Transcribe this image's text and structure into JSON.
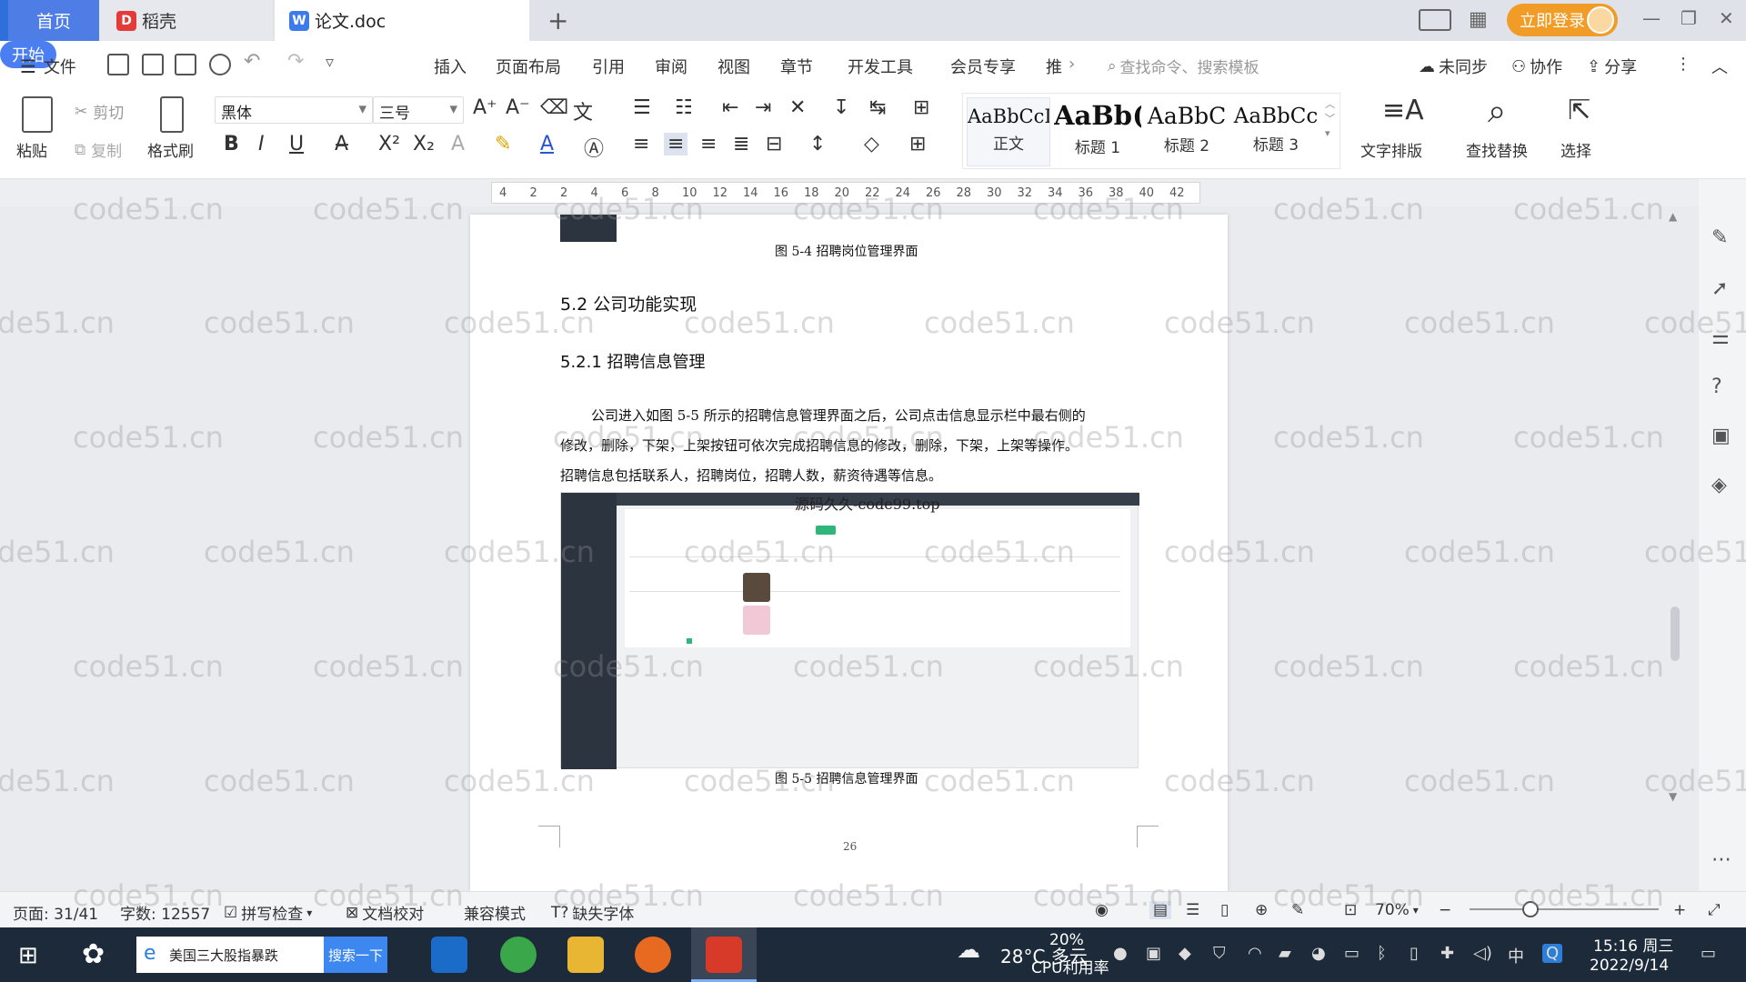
{
  "tabs": {
    "home": "首页",
    "daoke": "稻壳",
    "doc": "论文.doc",
    "new_tab": "+"
  },
  "top_right": {
    "login": "立即登录"
  },
  "menu": {
    "file": "文件",
    "items": [
      "开始",
      "插入",
      "页面布局",
      "引用",
      "审阅",
      "视图",
      "章节",
      "开发工具",
      "会员专享",
      "推"
    ],
    "search_cmd": "查找命令、搜索模板",
    "unsync": "未同步",
    "collab": "协作",
    "share": "分享"
  },
  "ribbon": {
    "paste": "粘贴",
    "cut": "剪切",
    "copy": "复制",
    "format_painter": "格式刷",
    "font": "黑体",
    "font_size": "三号",
    "styles": [
      {
        "sample": "AaBbCcI",
        "name": "正文"
      },
      {
        "sample": "AaBb(",
        "name": "标题 1"
      },
      {
        "sample": "AaBbC",
        "name": "标题 2"
      },
      {
        "sample": "AaBbCc",
        "name": "标题 3"
      }
    ],
    "text_layout": "文字排版",
    "find_replace": "查找替换",
    "select": "选择"
  },
  "ruler": {
    "ticks": [
      "4",
      "2",
      "2",
      "4",
      "6",
      "8",
      "10",
      "12",
      "14",
      "16",
      "18",
      "20",
      "22",
      "24",
      "26",
      "28",
      "30",
      "32",
      "34",
      "36",
      "38",
      "40",
      "42"
    ]
  },
  "document": {
    "caption_top": "图 5-4  招聘岗位管理界面",
    "section": "5.2 公司功能实现",
    "subsection": "5.2.1  招聘信息管理",
    "para_lines": [
      "公司进入如图 5-5 所示的招聘信息管理界面之后，公司点击信息显示栏中最右侧的",
      "修改，删除，下架，上架按钮可依次完成招聘信息的修改，删除，下架，上架等操作。",
      "招聘信息包括联系人，招聘岗位，招聘人数，薪资待遇等信息。"
    ],
    "overlay_text": "源码久久-code99.top",
    "caption_bottom": "图 5-5  招聘信息管理界面",
    "page_number": "26"
  },
  "watermark": "code51.cn",
  "status": {
    "page": "页面: 31/41",
    "words": "字数: 12557",
    "spell": "拼写检查",
    "doc_check": "文档校对",
    "compat": "兼容模式",
    "missing_font": "缺失字体",
    "zoom": "70%"
  },
  "taskbar": {
    "search_text": "美国三大股指暴跌",
    "search_btn": "搜索一下",
    "weather_temp": "28°C 多云",
    "cpu": "20%",
    "cpu_label": "CPU利用率",
    "ime": "中",
    "time": "15:16 周三",
    "date": "2022/9/14"
  }
}
